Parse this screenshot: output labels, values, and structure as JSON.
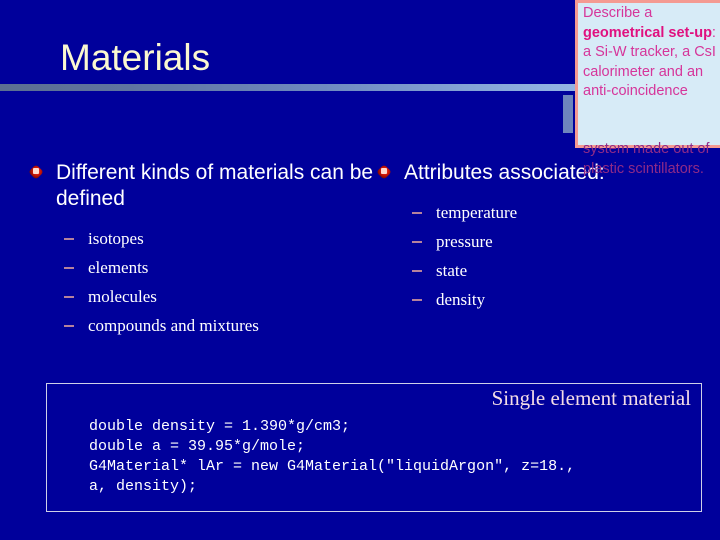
{
  "slide": {
    "title": "Materials",
    "background_color": "#00009b",
    "title_color": "#fbf8d0"
  },
  "columns": {
    "left": {
      "heading": "Different kinds of materials can be defined",
      "bullet_icon": "red-gem-bullet-icon",
      "items": [
        {
          "label": "isotopes"
        },
        {
          "label": "elements"
        },
        {
          "label": "molecules"
        },
        {
          "label": "compounds and mixtures"
        }
      ]
    },
    "right": {
      "heading": "Attributes associated:",
      "bullet_icon": "red-gem-bullet-icon",
      "items": [
        {
          "label": "temperature"
        },
        {
          "label": "pressure"
        },
        {
          "label": "state"
        },
        {
          "label": "density"
        }
      ]
    }
  },
  "code_block": {
    "caption": "Single element material",
    "caption_color": "#f4dde6",
    "border_color": "#cfd0e8",
    "code": "double density = 1.390*g/cm3;\ndouble a = 39.95*g/mole;\nG4Material* lAr = new G4Material(\"liquidArgon\", z=18.,\na, density);"
  },
  "callout": {
    "background_color": "#d7ebf7",
    "border_color": "#f49a92",
    "text_color": "#d6359a",
    "lead": "Describe a ",
    "emphasis": "geometrical set-up",
    "rest": ": a Si-W tracker, a CsI calorimeter and an anti-coincidence",
    "overflow": "system made out of plastic scintillators."
  }
}
